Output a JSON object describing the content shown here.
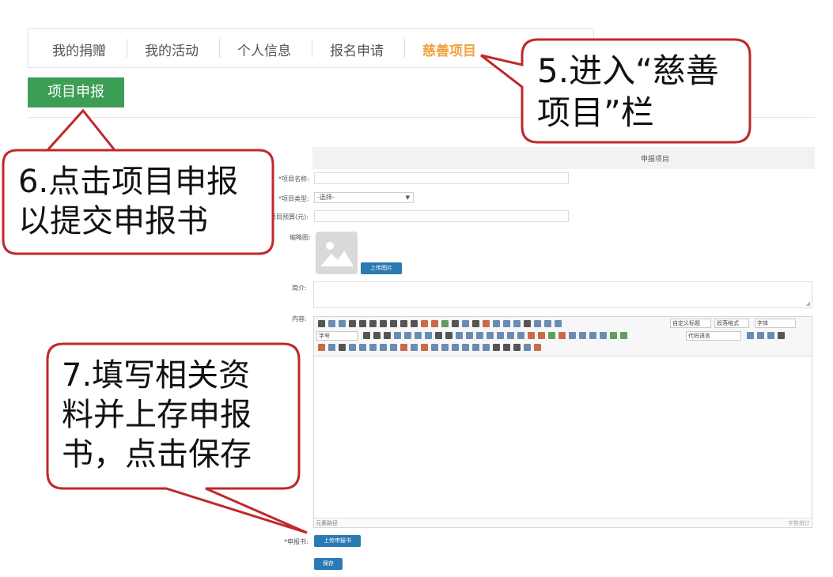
{
  "nav": {
    "items": [
      "我的捐赠",
      "我的活动",
      "个人信息",
      "报名申请",
      "慈善项目"
    ],
    "active_index": 4,
    "active_color": "#f0a23a"
  },
  "apply_button": {
    "label": "项目申报",
    "color": "#3c9d55"
  },
  "form": {
    "header": "申报项目",
    "name_label": "*项目名称:",
    "type_label": "*项目类型:",
    "type_value": "-选择-",
    "budget_label": "*项目预算(元):",
    "thumb_label": "缩略图:",
    "upload_image_label": "上传图片",
    "intro_label": "简介:",
    "content_label": "内容:",
    "editor": {
      "font_size_select": "字号",
      "heading_select": "自定义标题",
      "paragraph_select": "段落格式",
      "font_select": "字体",
      "code_select": "代码语言",
      "status_left": "元素路径",
      "status_right": "字数统计"
    },
    "report_label": "*申报书:",
    "upload_report_label": "上传申报书",
    "save_label": "保存",
    "button_color": "#2a7ab3"
  },
  "callouts": {
    "c5": [
      "5.进入“慈善",
      "项目”栏"
    ],
    "c6": [
      "6.点击项目申报",
      "以提交申报书"
    ],
    "c7": [
      "7.填写相关资",
      "料并上存申报",
      "书，点击保存"
    ],
    "border_color": "#c0282b"
  }
}
